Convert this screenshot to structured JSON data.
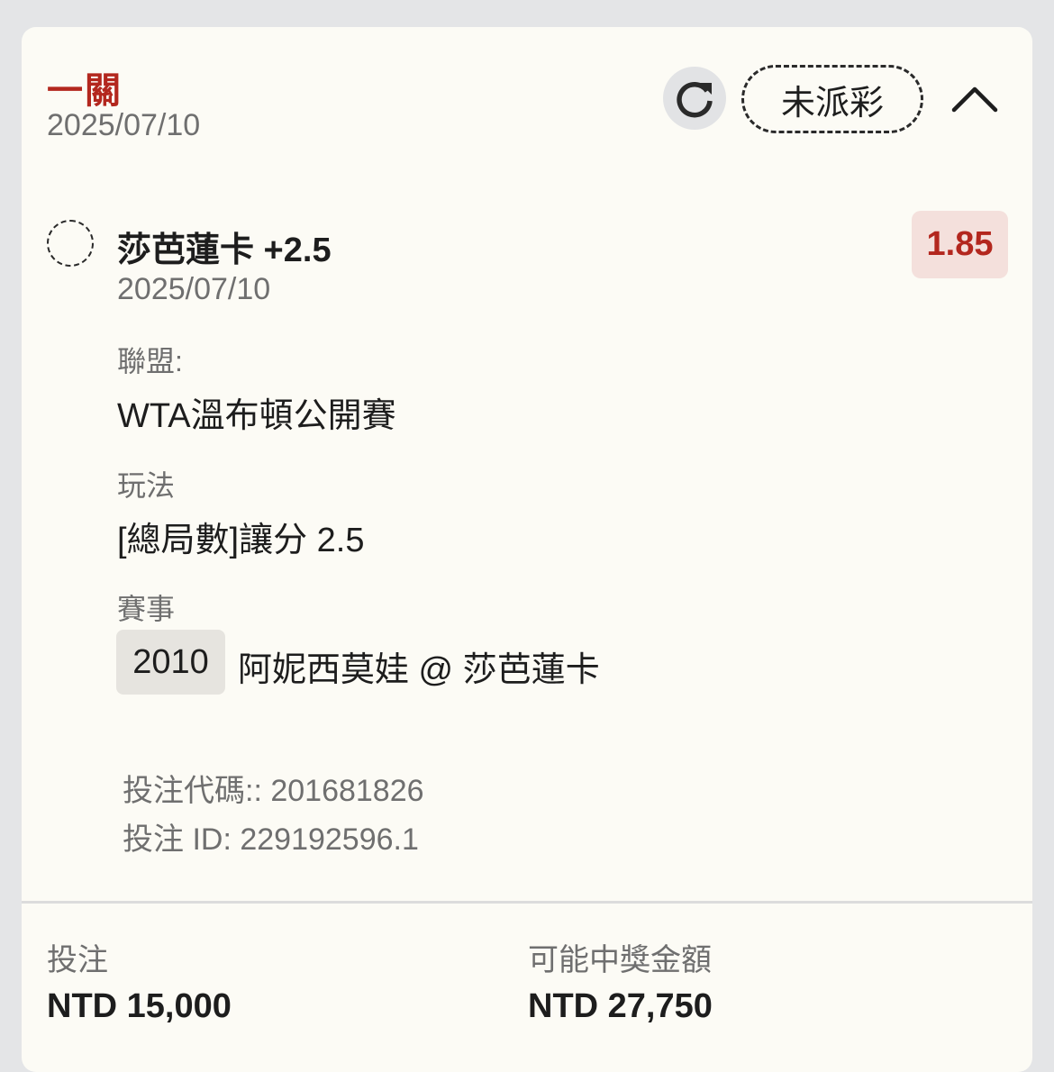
{
  "header": {
    "bet_type": "一關",
    "date": "2025/07/10",
    "status": "未派彩"
  },
  "selection": {
    "title": "莎芭蓮卡 +2.5",
    "date": "2025/07/10",
    "odds": "1.85"
  },
  "details": {
    "league_label": "聯盟:",
    "league_value": "WTA溫布頓公開賽",
    "market_label": "玩法",
    "market_value": "[總局數]讓分 2.5",
    "event_label": "賽事",
    "event_code": "2010",
    "event_name": "阿妮西莫娃 @ 莎芭蓮卡"
  },
  "meta": {
    "bet_code": "投注代碼:: 201681826",
    "bet_id": "投注 ID: 229192596.1"
  },
  "footer": {
    "stake_label": "投注",
    "stake_value": "NTD 15,000",
    "payout_label": "可能中獎金額",
    "payout_value": "NTD 27,750"
  },
  "icons": {
    "refresh": "refresh-icon",
    "collapse": "chevron-up-icon",
    "selection": "dashed-circle-icon"
  },
  "colors": {
    "accent": "#b3271e",
    "odds_bg": "#f4e0dc",
    "card_bg": "#fcfbf5"
  }
}
